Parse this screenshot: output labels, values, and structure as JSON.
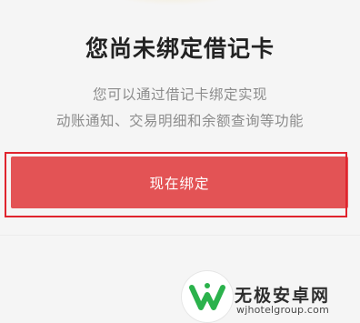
{
  "card": {
    "title": "您尚未绑定借记卡",
    "description_line1": "您可以通过借记卡绑定实现",
    "description_line2": "动账通知、交易明细和余额查询等功能",
    "bind_button_label": "现在绑定"
  },
  "watermark": {
    "site_name": "无极安卓网",
    "url": "wjhotelgroup.com"
  },
  "colors": {
    "button": "#e35355",
    "highlight_border": "#e0242e"
  }
}
